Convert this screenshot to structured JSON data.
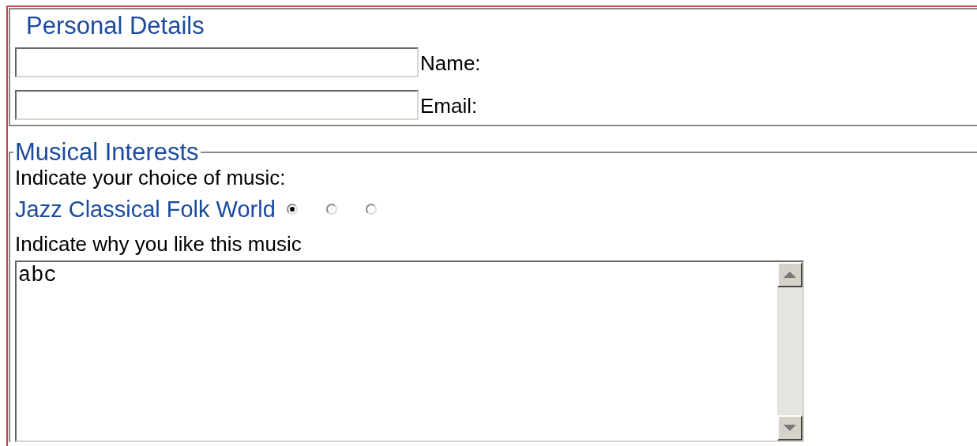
{
  "personal_details": {
    "title": "Personal Details",
    "fields": [
      {
        "label": "Name:"
      },
      {
        "label": "Email:"
      }
    ]
  },
  "musical_interests": {
    "title": "Musical Interests",
    "choice_prompt": "Indicate your choice of music:",
    "choice_labels": "Jazz Classical Folk World",
    "choices": [
      {
        "selected": true
      },
      {
        "selected": false
      },
      {
        "selected": false
      }
    ],
    "reason_prompt": "Indicate why you like this music",
    "reason": {
      "value": "abc"
    }
  }
}
